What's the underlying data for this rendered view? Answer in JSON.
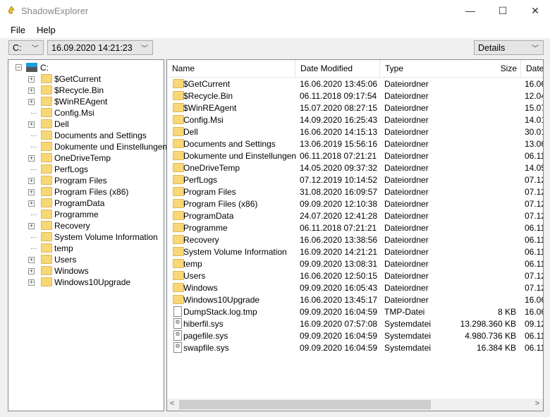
{
  "window": {
    "title": "ShadowExplorer",
    "minimize": "—",
    "maximize": "☐",
    "close": "✕"
  },
  "menu": [
    "File",
    "Help"
  ],
  "toolbar": {
    "drive": "C:",
    "snapshot": "16.09.2020 14:21:23",
    "view": "Details"
  },
  "tree": {
    "root": "C:",
    "items": [
      {
        "label": "$GetCurrent",
        "expandable": true
      },
      {
        "label": "$Recycle.Bin",
        "expandable": true
      },
      {
        "label": "$WinREAgent",
        "expandable": true
      },
      {
        "label": "Config.Msi",
        "expandable": false
      },
      {
        "label": "Dell",
        "expandable": true
      },
      {
        "label": "Documents and Settings",
        "expandable": false
      },
      {
        "label": "Dokumente und Einstellungen",
        "expandable": false
      },
      {
        "label": "OneDriveTemp",
        "expandable": true
      },
      {
        "label": "PerfLogs",
        "expandable": false
      },
      {
        "label": "Program Files",
        "expandable": true
      },
      {
        "label": "Program Files (x86)",
        "expandable": true
      },
      {
        "label": "ProgramData",
        "expandable": true
      },
      {
        "label": "Programme",
        "expandable": false
      },
      {
        "label": "Recovery",
        "expandable": true
      },
      {
        "label": "System Volume Information",
        "expandable": false
      },
      {
        "label": "temp",
        "expandable": false
      },
      {
        "label": "Users",
        "expandable": true
      },
      {
        "label": "Windows",
        "expandable": true
      },
      {
        "label": "Windows10Upgrade",
        "expandable": true
      }
    ]
  },
  "list": {
    "columns": [
      "Name",
      "Date Modified",
      "Type",
      "Size",
      "Date"
    ],
    "rows": [
      {
        "icon": "folder",
        "name": "$GetCurrent",
        "modified": "16.06.2020 13:45:06",
        "type": "Dateiordner",
        "size": "",
        "date": "16.06"
      },
      {
        "icon": "folder",
        "name": "$Recycle.Bin",
        "modified": "06.11.2018 09:17:54",
        "type": "Dateiordner",
        "size": "",
        "date": "12.04"
      },
      {
        "icon": "folder",
        "name": "$WinREAgent",
        "modified": "15.07.2020 08:27:15",
        "type": "Dateiordner",
        "size": "",
        "date": "15.07"
      },
      {
        "icon": "folder",
        "name": "Config.Msi",
        "modified": "14.09.2020 16:25:43",
        "type": "Dateiordner",
        "size": "",
        "date": "14.01"
      },
      {
        "icon": "folder",
        "name": "Dell",
        "modified": "16.06.2020 14:15:13",
        "type": "Dateiordner",
        "size": "",
        "date": "30.01"
      },
      {
        "icon": "folder",
        "name": "Documents and Settings",
        "modified": "13.06.2019 15:56:16",
        "type": "Dateiordner",
        "size": "",
        "date": "13.06"
      },
      {
        "icon": "folder",
        "name": "Dokumente und Einstellungen",
        "modified": "06.11.2018 07:21:21",
        "type": "Dateiordner",
        "size": "",
        "date": "06.11"
      },
      {
        "icon": "folder",
        "name": "OneDriveTemp",
        "modified": "14.05.2020 09:37:32",
        "type": "Dateiordner",
        "size": "",
        "date": "14.05"
      },
      {
        "icon": "folder",
        "name": "PerfLogs",
        "modified": "07.12.2019 10:14:52",
        "type": "Dateiordner",
        "size": "",
        "date": "07.12"
      },
      {
        "icon": "folder",
        "name": "Program Files",
        "modified": "31.08.2020 16:09:57",
        "type": "Dateiordner",
        "size": "",
        "date": "07.12"
      },
      {
        "icon": "folder",
        "name": "Program Files (x86)",
        "modified": "09.09.2020 12:10:38",
        "type": "Dateiordner",
        "size": "",
        "date": "07.12"
      },
      {
        "icon": "folder",
        "name": "ProgramData",
        "modified": "24.07.2020 12:41:28",
        "type": "Dateiordner",
        "size": "",
        "date": "07.12"
      },
      {
        "icon": "folder",
        "name": "Programme",
        "modified": "06.11.2018 07:21:21",
        "type": "Dateiordner",
        "size": "",
        "date": "06.11"
      },
      {
        "icon": "folder",
        "name": "Recovery",
        "modified": "16.06.2020 13:38:56",
        "type": "Dateiordner",
        "size": "",
        "date": "06.11"
      },
      {
        "icon": "folder",
        "name": "System Volume Information",
        "modified": "16.09.2020 14:21:21",
        "type": "Dateiordner",
        "size": "",
        "date": "06.11"
      },
      {
        "icon": "folder",
        "name": "temp",
        "modified": "09.09.2020 13:08:31",
        "type": "Dateiordner",
        "size": "",
        "date": "06.11"
      },
      {
        "icon": "folder",
        "name": "Users",
        "modified": "16.06.2020 12:50:15",
        "type": "Dateiordner",
        "size": "",
        "date": "07.12"
      },
      {
        "icon": "folder",
        "name": "Windows",
        "modified": "09.09.2020 16:05:43",
        "type": "Dateiordner",
        "size": "",
        "date": "07.12"
      },
      {
        "icon": "folder",
        "name": "Windows10Upgrade",
        "modified": "16.06.2020 13:45:17",
        "type": "Dateiordner",
        "size": "",
        "date": "16.06"
      },
      {
        "icon": "file",
        "name": "DumpStack.log.tmp",
        "modified": "09.09.2020 16:04:59",
        "type": "TMP-Datei",
        "size": "8 KB",
        "date": "16.06"
      },
      {
        "icon": "sysfile",
        "name": "hiberfil.sys",
        "modified": "16.09.2020 07:57:08",
        "type": "Systemdatei",
        "size": "13.298.360 KB",
        "date": "09.12"
      },
      {
        "icon": "sysfile",
        "name": "pagefile.sys",
        "modified": "09.09.2020 16:04:59",
        "type": "Systemdatei",
        "size": "4.980.736 KB",
        "date": "06.11"
      },
      {
        "icon": "sysfile",
        "name": "swapfile.sys",
        "modified": "09.09.2020 16:04:59",
        "type": "Systemdatei",
        "size": "16.384 KB",
        "date": "06.11"
      }
    ]
  },
  "scroll": {
    "left": "<",
    "right": ">"
  }
}
